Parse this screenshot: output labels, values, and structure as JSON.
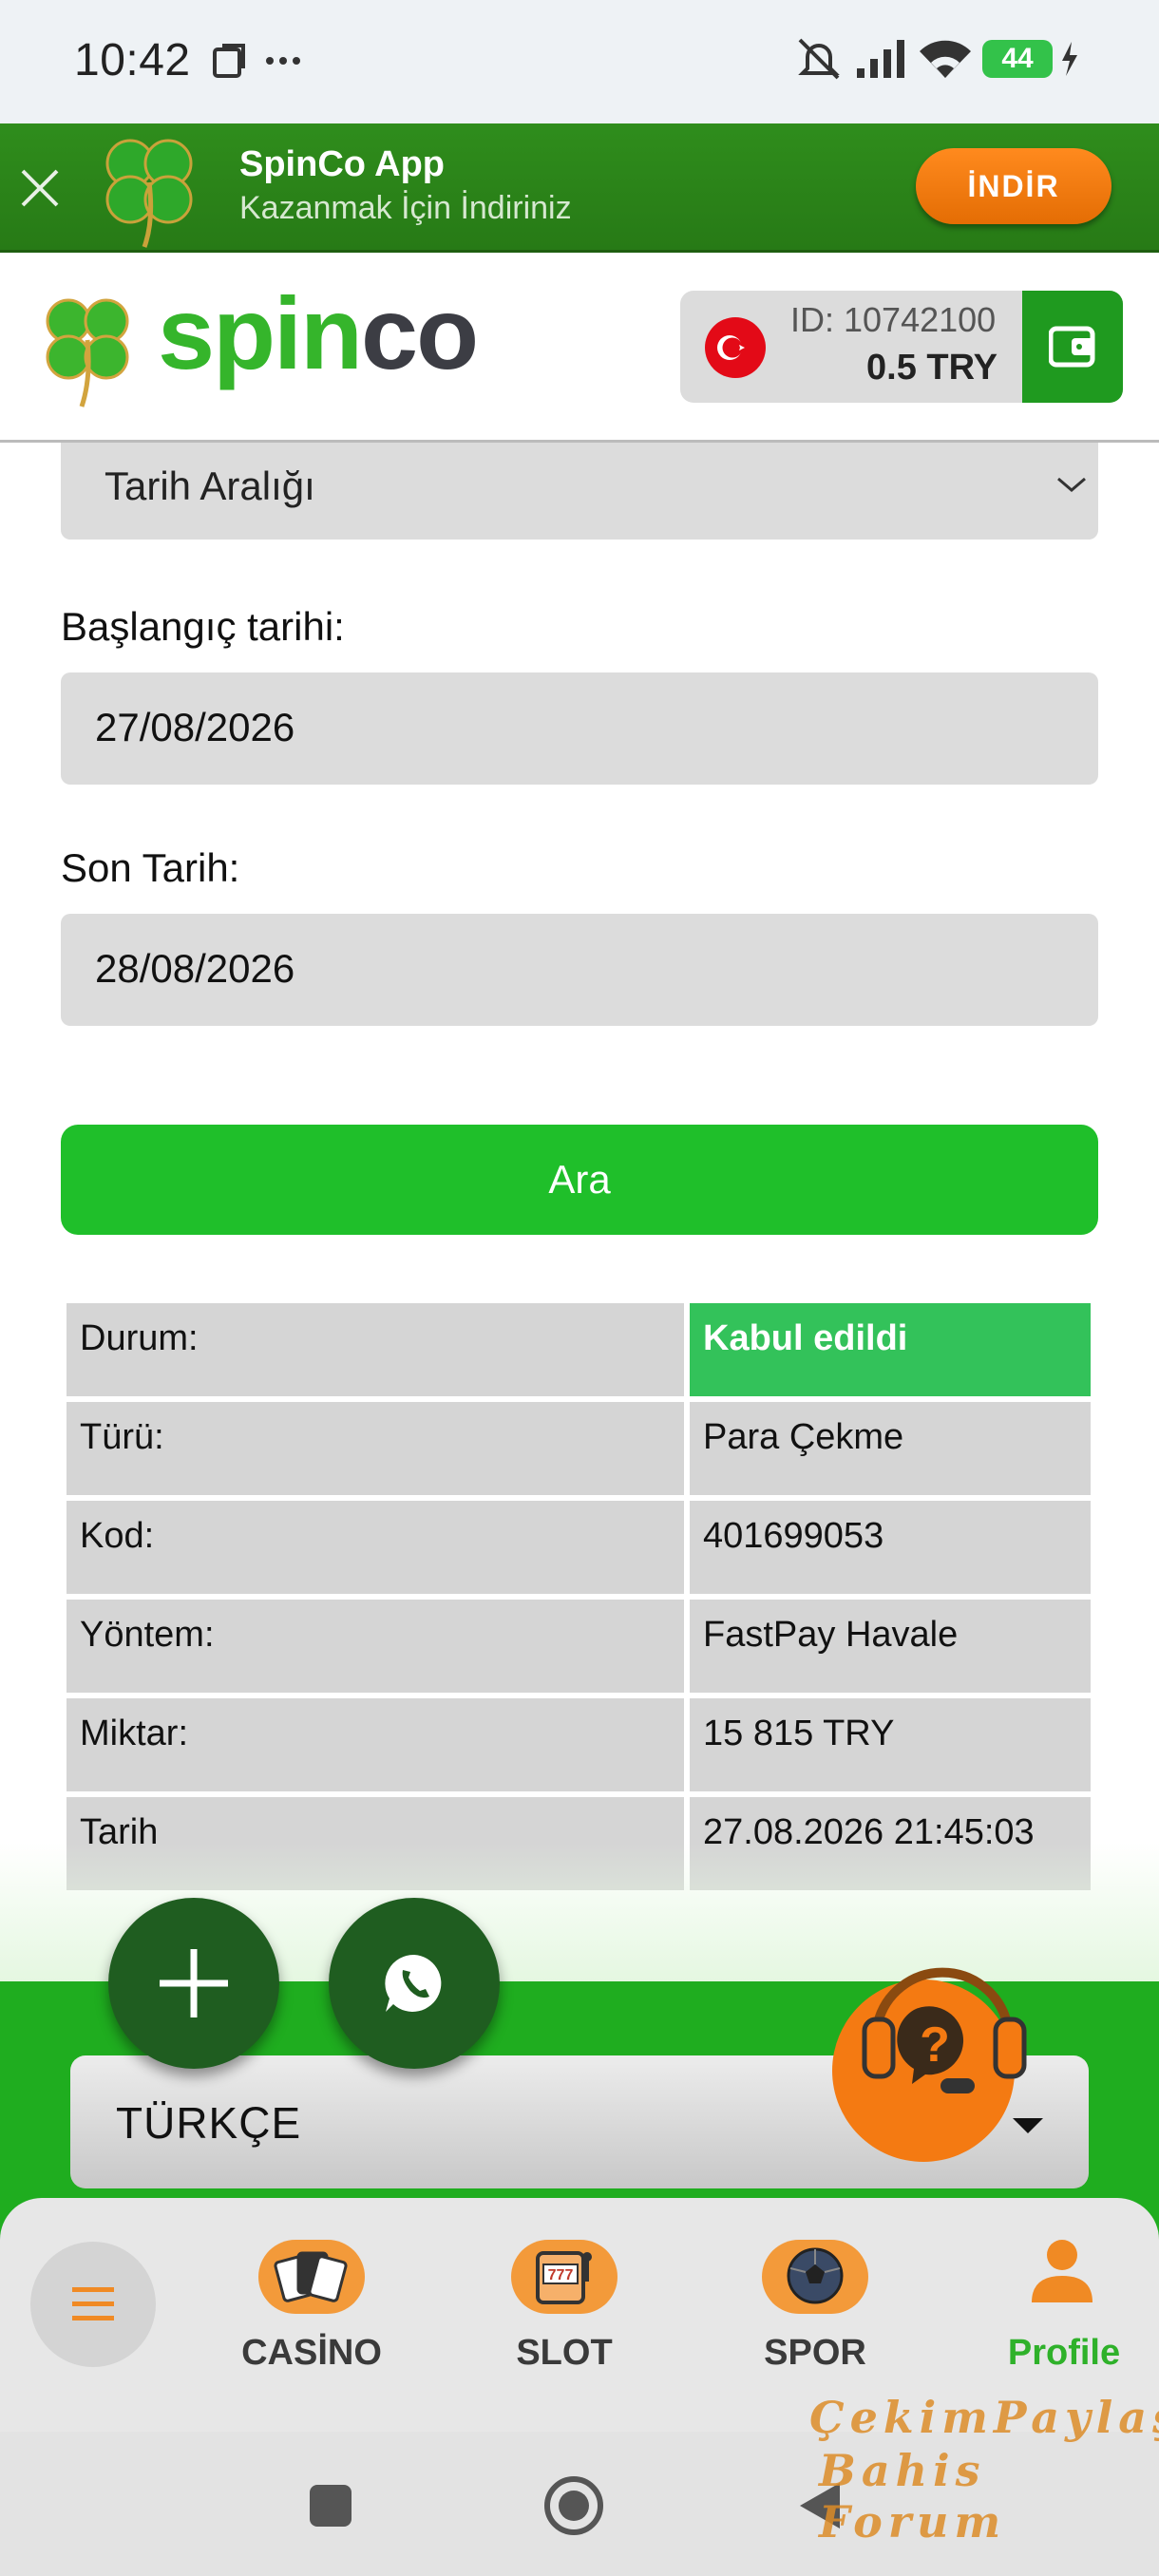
{
  "status_bar": {
    "time": "10:42",
    "battery": "44",
    "icons": [
      "screenshot-icon",
      "more-icon",
      "mute-icon",
      "signal-icon",
      "wifi-icon",
      "charging-icon"
    ]
  },
  "app_banner": {
    "title": "SpinCo App",
    "subtitle": "Kazanmak İçin İndiriniz",
    "download_label": "İNDİR",
    "close_icon": "close-icon"
  },
  "header": {
    "logo_part1": "spin",
    "logo_part2": "co",
    "account_id": "ID: 10742100",
    "balance": "0.5   TRY",
    "flag": "turkey-flag",
    "colors": {
      "brand_green": "#35b52b",
      "logo_dark": "#3c3d44"
    }
  },
  "form": {
    "range_select": "Tarih Aralığı",
    "start_label": "Başlangıç tarihi:",
    "start_value": "27/08/2026",
    "end_label": "Son Tarih:",
    "end_value": "28/08/2026",
    "search_label": "Ara"
  },
  "details_table": {
    "rows": [
      {
        "label": "Durum:",
        "value": "Kabul edildi"
      },
      {
        "label": "Türü:",
        "value": "Para Çekme"
      },
      {
        "label": "Kod:",
        "value": "401699053"
      },
      {
        "label": "Yöntem:",
        "value": "FastPay Havale"
      },
      {
        "label": "Miktar:",
        "value": "15 815 TRY"
      },
      {
        "label": "Tarih",
        "value": "27.08.2026 21:45:03"
      }
    ],
    "accepted_color": "#33c25a"
  },
  "footer": {
    "language": "TÜRKÇE",
    "fab_icons": [
      "plus-icon",
      "whatsapp-icon"
    ],
    "support_icon": "support-headset-icon"
  },
  "bottom_nav": {
    "items": [
      {
        "label": "CASİNO",
        "icon": "cards-icon"
      },
      {
        "label": "SLOT",
        "icon": "slot-machine-icon"
      },
      {
        "label": "SPOR",
        "icon": "ball-icon"
      },
      {
        "label": "Profile",
        "icon": "user-icon"
      }
    ],
    "active_color": "#2fb12a"
  },
  "watermark": {
    "line1": "ÇekimPaylaş",
    "line2": "Bahis Forum"
  }
}
